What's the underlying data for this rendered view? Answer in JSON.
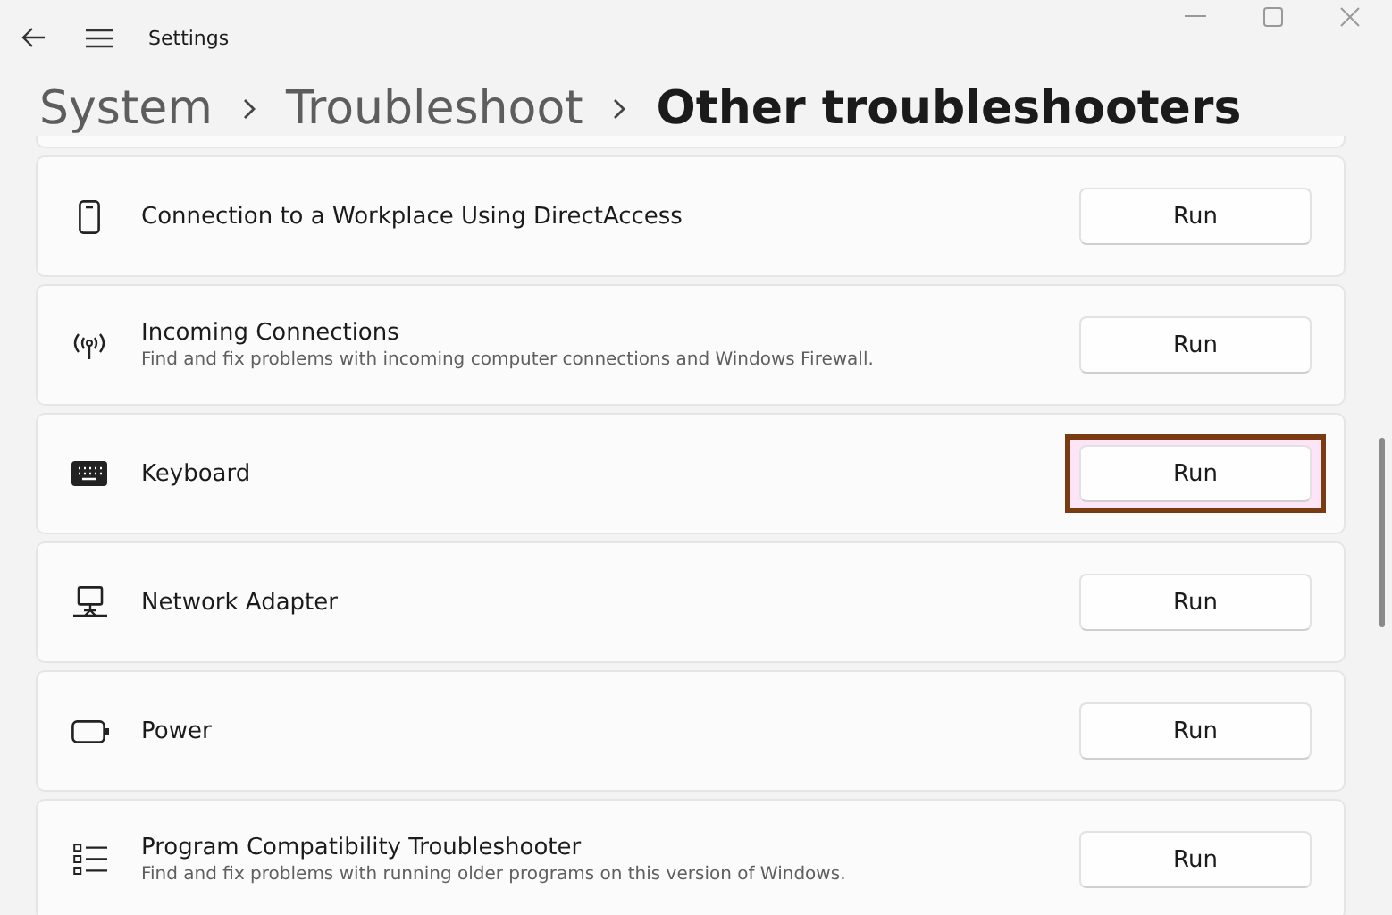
{
  "window": {
    "title": "Settings"
  },
  "breadcrumb": [
    {
      "label": "System",
      "current": false
    },
    {
      "label": "Troubleshoot",
      "current": false
    },
    {
      "label": "Other troubleshooters",
      "current": true
    }
  ],
  "troubleshooters": [
    {
      "title": "Connection to a Workplace Using DirectAccess",
      "button": "Run",
      "highlighted": false
    },
    {
      "title": "Incoming Connections",
      "description": "Find and fix problems with incoming computer connections and Windows Firewall.",
      "button": "Run",
      "highlighted": false
    },
    {
      "title": "Keyboard",
      "button": "Run",
      "highlighted": true
    },
    {
      "title": "Network Adapter",
      "button": "Run",
      "highlighted": false
    },
    {
      "title": "Power",
      "button": "Run",
      "highlighted": false
    },
    {
      "title": "Program Compatibility Troubleshooter",
      "description": "Find and fix problems with running older programs on this version of Windows.",
      "button": "Run",
      "highlighted": false
    }
  ]
}
